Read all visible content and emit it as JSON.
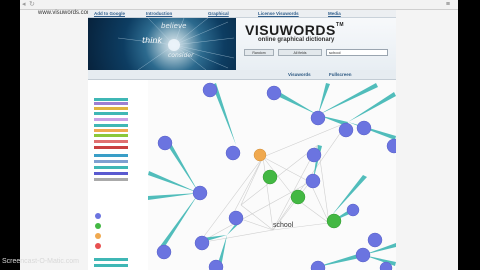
{
  "browser": {
    "url": "www.visuwords.com"
  },
  "site": {
    "top_menu": [
      "Add to Google",
      "Introduction",
      "Graphical",
      "License Visuwords",
      "Media"
    ],
    "banner": {
      "words": [
        "believe",
        "think",
        "consider"
      ],
      "logo": "VISUWORDS",
      "logo_tm": "TM",
      "tagline": "online graphical dictionary"
    },
    "search": {
      "buttons": [
        "Random",
        "All fields"
      ],
      "value": "school"
    },
    "tabs": [
      "Visuwords",
      "Fullscreen"
    ],
    "center_word": "school",
    "colors": {
      "noun": "#6b74e0",
      "verb": "#43b843",
      "adjective": "#f0a94f",
      "link": "#3fb7b5"
    }
  },
  "watermark": "Screencast-O-Matic.com"
}
